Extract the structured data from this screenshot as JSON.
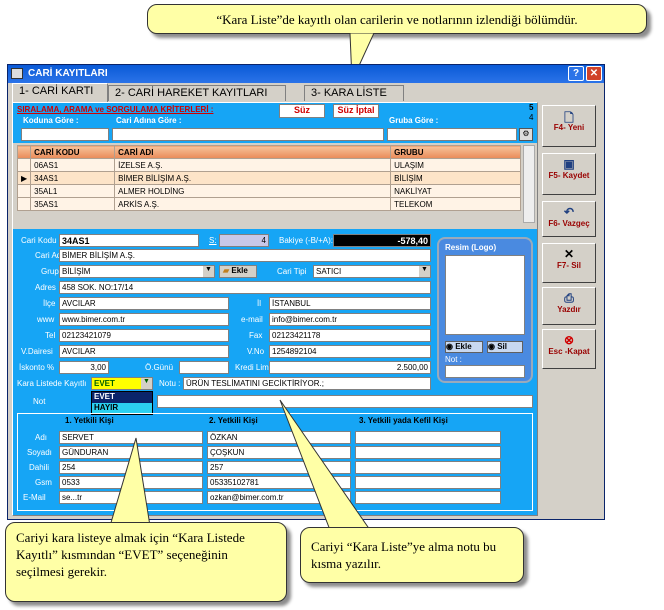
{
  "callouts": {
    "top": "“Kara Liste”de kayıtlı olan carilerin ve notlarının izlendiği bölümdür.",
    "bottom_left": "Cariyi kara listeye almak için “Kara Listede Kayıtlı” kısmından “EVET” seçeneğinin seçilmesi gerekir.",
    "bottom_right": "Cariyi “Kara Liste”ye alma notu bu kısma yazılır."
  },
  "window": {
    "title": "CARİ KAYITLARI"
  },
  "tabs": [
    "1- CARİ KARTI",
    "2- CARİ HAREKET KAYITLARI",
    "3- KARA LİSTE"
  ],
  "filter": {
    "heading": "SIRALAMA, ARAMA ve SORGULAMA KRİTERLERİ :",
    "suz": "Süz",
    "suz_iptal": "Süz İptal",
    "kod_label": "Koduna Göre :",
    "ad_label": "Cari Adına Göre :",
    "grup_label": "Gruba Göre :",
    "count_a": "5",
    "count_b": "4"
  },
  "grid": {
    "headers": [
      "CARİ KODU",
      "CARİ ADI",
      "GRUBU"
    ],
    "rows": [
      [
        "06AS1",
        "İZELSE A.Ş.",
        "ULAŞIM"
      ],
      [
        "34AS1",
        "BİMER BİLİŞİM A.Ş.",
        "BİLİŞİM"
      ],
      [
        "35AL1",
        "ALMER HOLDİNG",
        "NAKLİYAT"
      ],
      [
        "35AS1",
        "ARKİS A.Ş.",
        "TELEKOM"
      ]
    ]
  },
  "form": {
    "cari_kodu_label": "Cari Kodu :",
    "cari_kodu": "34AS1",
    "s_label": "S:",
    "s_value": "4",
    "bakiye_label": "Bakiye (-B/+A):",
    "bakiye": "-578,40",
    "cari_adi_label": "Cari Adı",
    "cari_adi": "BİMER BİLİŞİM A.Ş.",
    "grup_label": "Grup",
    "grup": "BİLİŞİM",
    "ekle": "Ekle",
    "cari_tipi_label": "Cari Tipi",
    "cari_tipi": "SATICI",
    "adres_label": "Adres",
    "adres": "458 SOK. NO:17/14",
    "ilce_label": "İlçe",
    "ilce": "AVCILAR",
    "il_label": "İl",
    "il": "İSTANBUL",
    "www_label": "www",
    "www": "www.bimer.com.tr",
    "email_label": "e-mail",
    "email": "info@bimer.com.tr",
    "tel_label": "Tel",
    "tel": "02123421079",
    "fax_label": "Fax",
    "fax": "02123421178",
    "vdairesi_label": "V.Dairesi",
    "vdairesi": "AVCILAR",
    "vno_label": "V.No",
    "vno": "1254892104",
    "iskonto_label": "İskonto %",
    "iskonto": "3,00",
    "ogunu_label": "Ö.Günü",
    "ogunu": "",
    "kredi_label": "Kredi Limiti",
    "kredi": "2.500,00",
    "kara_label": "Kara Listede Kayıtlı",
    "kara": "EVET",
    "kara_options": [
      "EVET",
      "HAYIR"
    ],
    "notu_label": "Notu :",
    "notu": "ÜRÜN TESLİMATINI GECİKTİRİYOR.;",
    "not_label": "Not"
  },
  "logo": {
    "title": "Resim (Logo)",
    "ekle": "Ekle",
    "sil": "Sil",
    "not_label": "Not :"
  },
  "yetkili": {
    "headers": [
      "1. Yetkili Kişi",
      "2. Yetkili Kişi",
      "3. Yetkili yada Kefil Kişi"
    ],
    "labels": [
      "Adı",
      "Soyadı",
      "Dahili",
      "Gsm",
      "E-Mail"
    ],
    "col1": [
      "SERVET",
      "GÜNDURAN",
      "254",
      "0533",
      "se...tr"
    ],
    "col2": [
      "ÖZKAN",
      "ÇOŞKUN",
      "257",
      "05335102781",
      "ozkan@bimer.com.tr"
    ],
    "col3": [
      "",
      "",
      "",
      "",
      ""
    ]
  },
  "buttons": [
    {
      "label": "F4- Yeni",
      "icon": "new-doc-icon"
    },
    {
      "label": "F5- Kaydet",
      "icon": "save-icon"
    },
    {
      "label": "F6- Vazgeç",
      "icon": "undo-icon"
    },
    {
      "label": "F7- Sil",
      "icon": "delete-x-icon"
    },
    {
      "label": "Yazdır",
      "icon": "print-icon"
    },
    {
      "label": "Esc -Kapat",
      "icon": "close-icon"
    }
  ],
  "colors": {
    "titlebar": "#0a5ad6",
    "panel_blue": "#16a5f5",
    "accent_red": "#d00000",
    "callout": "#ffffa6"
  }
}
